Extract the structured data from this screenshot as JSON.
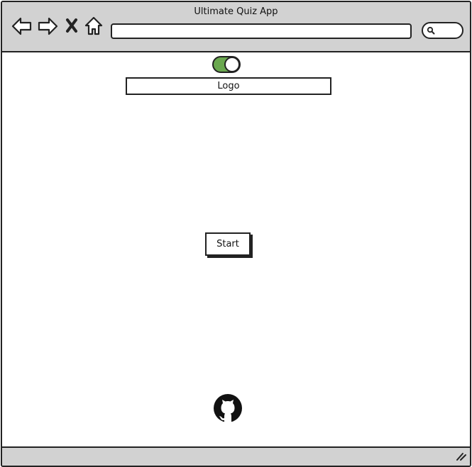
{
  "window": {
    "title": "Ultimate Quiz App"
  },
  "toolbar": {
    "icons": [
      "back-arrow-icon",
      "forward-arrow-icon",
      "close-icon",
      "home-icon",
      "search-icon"
    ],
    "url": "",
    "search_value": ""
  },
  "main": {
    "toggle": {
      "state": "on",
      "color": "#6aa84f"
    },
    "logo_label": "Logo",
    "start_label": "Start",
    "footer_icon": "github-icon"
  },
  "colors": {
    "chrome": "#d2d2d2",
    "outline": "#222222"
  }
}
